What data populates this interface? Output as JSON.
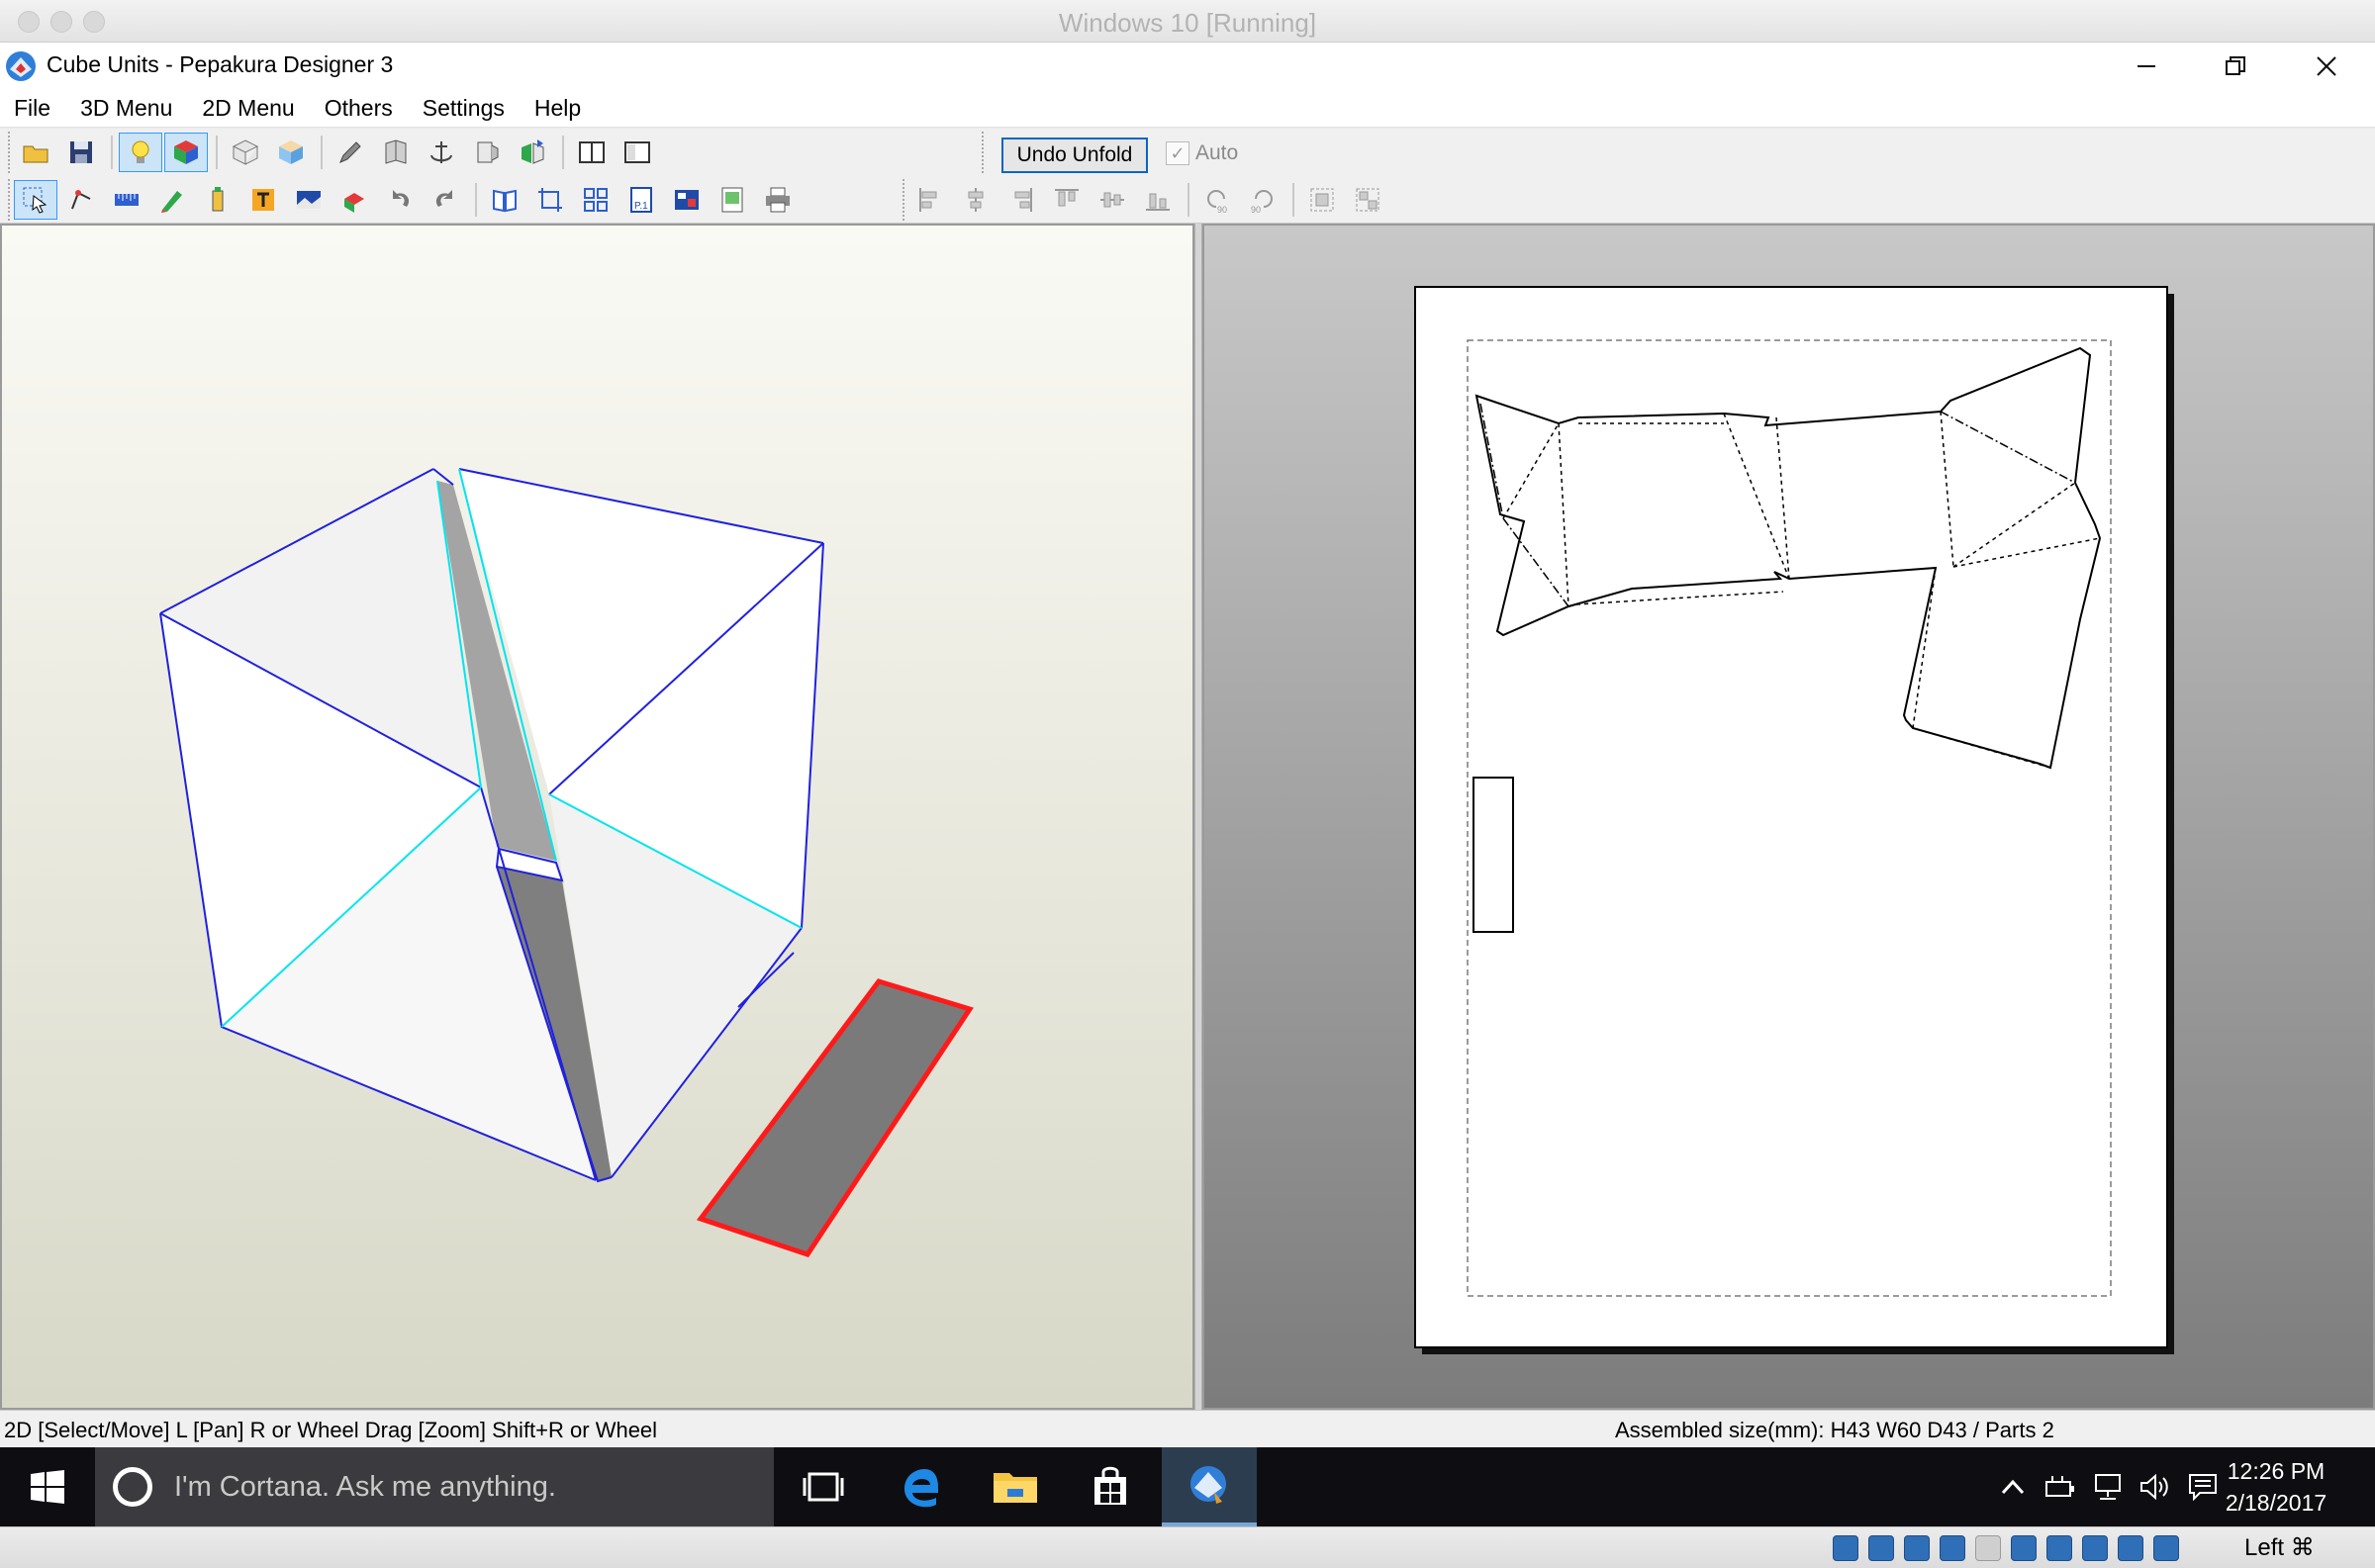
{
  "host": {
    "title": "Windows 10 [Running]",
    "host_key": "Left ⌘"
  },
  "app": {
    "title": "Cube Units  - Pepakura Designer 3",
    "menu": [
      "File",
      "3D Menu",
      "2D Menu",
      "Others",
      "Settings",
      "Help"
    ],
    "undo_unfold_label": "Undo Unfold",
    "auto_label": "Auto",
    "auto_checked": true
  },
  "status": {
    "left": "2D [Select/Move] L [Pan] R or Wheel Drag [Zoom] Shift+R or Wheel",
    "right": "Assembled size(mm): H43 W60 D43 / Parts 2"
  },
  "taskbar": {
    "cortana_placeholder": "I'm Cortana. Ask me anything.",
    "time": "12:26 PM",
    "date": "2/18/2017"
  },
  "colors": {
    "edge_selected": "#2020e0",
    "edge_highlight": "#00e5ee",
    "part_selected_outline": "#ff1a1a",
    "part_fill": "#7a7a7a"
  },
  "icons": {
    "toolbar_row1": [
      "open-folder-icon",
      "save-icon",
      "lightbulb-icon",
      "color-cube-icon",
      "wireframe-cube-icon",
      "texture-cube-icon",
      "pencil-icon",
      "fold-icon",
      "anchor-icon",
      "flap-icon",
      "unfold-icon",
      "single-pane-icon",
      "dual-pane-icon"
    ],
    "toolbar_row2": [
      "select-arrow-icon",
      "edge-tool-icon",
      "ruler-icon",
      "brush-icon",
      "glue-flap-icon",
      "text-icon",
      "image-icon",
      "move-icon",
      "rotate-ccw-icon",
      "rotate-cw-icon",
      "book-icon",
      "crop-icon",
      "grid-icon",
      "page-number-icon",
      "layout-icon",
      "print-preview-icon",
      "print-icon"
    ],
    "align_tools": [
      "align-left-icon",
      "align-center-h-icon",
      "align-right-icon",
      "align-top-icon",
      "align-center-v-icon",
      "align-bottom-icon",
      "rotate-90-ccw-icon",
      "rotate-90-cw-icon",
      "group-icon",
      "ungroup-icon"
    ]
  }
}
